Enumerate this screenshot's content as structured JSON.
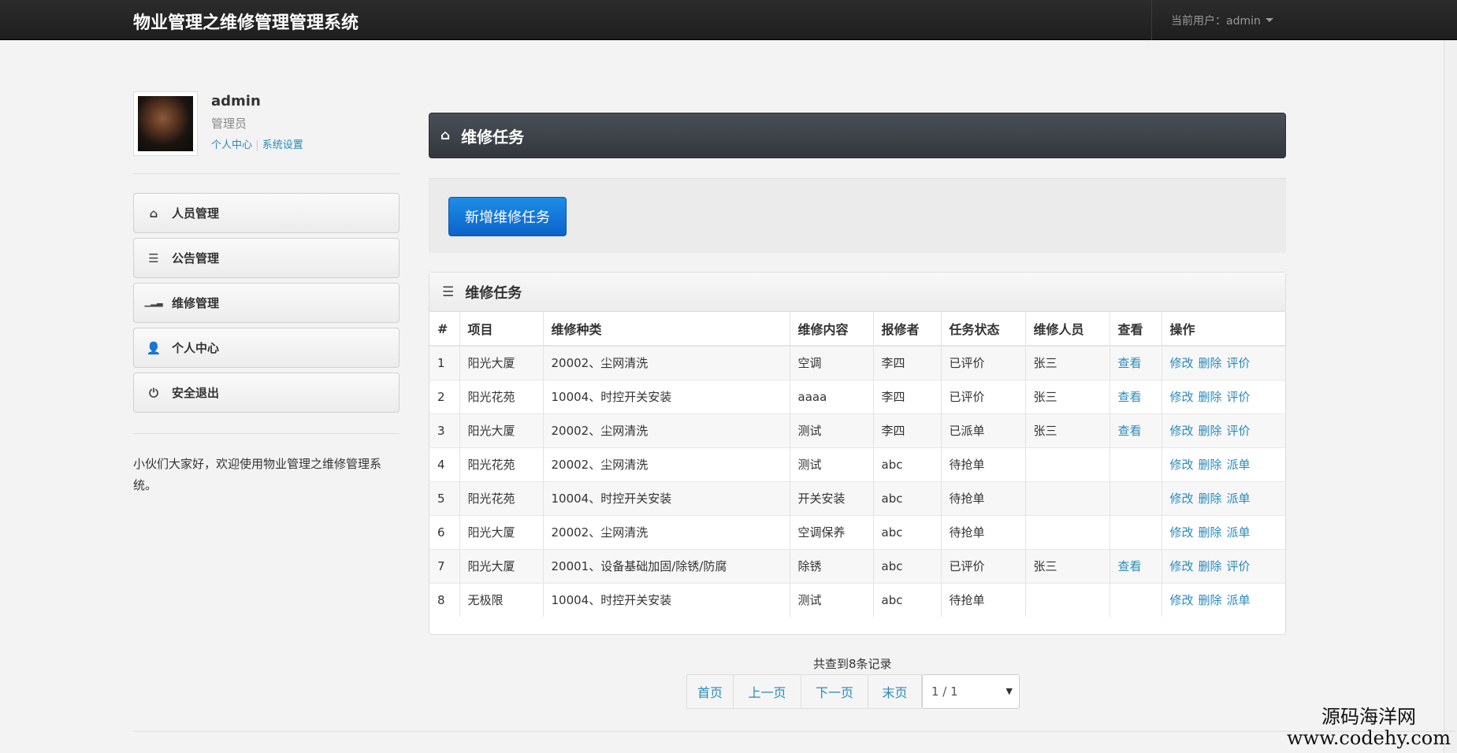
{
  "navbar": {
    "brand": "物业管理之维修管理管理系统",
    "current_user": "当前用户：admin"
  },
  "profile": {
    "name": "admin",
    "role": "管理员",
    "link_center": "个人中心",
    "link_sep": "|",
    "link_settings": "系统设置"
  },
  "menu": [
    {
      "label": "人员管理",
      "icon": "⌂"
    },
    {
      "label": "公告管理",
      "icon": "☰"
    },
    {
      "label": "维修管理",
      "icon": "▁▂▃"
    },
    {
      "label": "个人中心",
      "icon": "👤"
    },
    {
      "label": "安全退出",
      "icon": "⏻"
    }
  ],
  "welcome": "小伙们大家好，欢迎使用物业管理之维修管理系统。",
  "main": {
    "header_title": "维修任务",
    "add_button": "新增维修任务",
    "panel_title": "维修任务",
    "columns": [
      "#",
      "项目",
      "维修种类",
      "维修内容",
      "报修者",
      "任务状态",
      "维修人员",
      "查看",
      "操作"
    ],
    "rows": [
      {
        "no": "1",
        "project": "阳光大厦",
        "type": "20002、尘网清洗",
        "content": "空调",
        "reporter": "李四",
        "status": "已评价",
        "worker": "张三",
        "view": "查看",
        "actions": [
          "修改",
          "删除",
          "评价"
        ]
      },
      {
        "no": "2",
        "project": "阳光花苑",
        "type": "10004、时控开关安装",
        "content": "aaaa",
        "reporter": "李四",
        "status": "已评价",
        "worker": "张三",
        "view": "查看",
        "actions": [
          "修改",
          "删除",
          "评价"
        ]
      },
      {
        "no": "3",
        "project": "阳光大厦",
        "type": "20002、尘网清洗",
        "content": "测试",
        "reporter": "李四",
        "status": "已派单",
        "worker": "张三",
        "view": "查看",
        "actions": [
          "修改",
          "删除",
          "评价"
        ]
      },
      {
        "no": "4",
        "project": "阳光花苑",
        "type": "20002、尘网清洗",
        "content": "测试",
        "reporter": "abc",
        "status": "待抢单",
        "worker": "",
        "view": "",
        "actions": [
          "修改",
          "删除",
          "派单"
        ]
      },
      {
        "no": "5",
        "project": "阳光花苑",
        "type": "10004、时控开关安装",
        "content": "开关安装",
        "reporter": "abc",
        "status": "待抢单",
        "worker": "",
        "view": "",
        "actions": [
          "修改",
          "删除",
          "派单"
        ]
      },
      {
        "no": "6",
        "project": "阳光大厦",
        "type": "20002、尘网清洗",
        "content": "空调保养",
        "reporter": "abc",
        "status": "待抢单",
        "worker": "",
        "view": "",
        "actions": [
          "修改",
          "删除",
          "派单"
        ]
      },
      {
        "no": "7",
        "project": "阳光大厦",
        "type": "20001、设备基础加固/除锈/防腐",
        "content": "除锈",
        "reporter": "abc",
        "status": "已评价",
        "worker": "张三",
        "view": "查看",
        "actions": [
          "修改",
          "删除",
          "评价"
        ]
      },
      {
        "no": "8",
        "project": "无极限",
        "type": "10004、时控开关安装",
        "content": "测试",
        "reporter": "abc",
        "status": "待抢单",
        "worker": "",
        "view": "",
        "actions": [
          "修改",
          "删除",
          "派单"
        ]
      }
    ]
  },
  "pagination": {
    "records": "共查到8条记录",
    "first": "首页",
    "prev": "上一页",
    "next": "下一页",
    "last": "末页",
    "page_select": "1 / 1"
  },
  "watermark": {
    "line1": "源码海洋网",
    "line2": "www.codehy.com"
  }
}
